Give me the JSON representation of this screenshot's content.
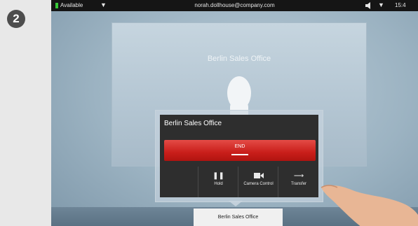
{
  "step_badge": "2",
  "status_bar": {
    "availability": "Available",
    "uri": "norah.dollhouse@company.com",
    "clock": "15:4"
  },
  "remote_video": {
    "site_name": "Berlin Sales Office"
  },
  "call_popup": {
    "title": "Berlin Sales Office",
    "end_label": "END",
    "actions": [
      {
        "icon": "pause-icon",
        "label": "Hold"
      },
      {
        "icon": "camera-icon",
        "label": "Camera Control"
      },
      {
        "icon": "transfer-arrow-icon",
        "label": "Transfer"
      }
    ]
  },
  "bottom_tab": {
    "label": "Berlin Sales Office"
  },
  "colors": {
    "status_available": "#37c837",
    "end_red": "#c91e1a",
    "status_bar_bg": "#151515"
  }
}
